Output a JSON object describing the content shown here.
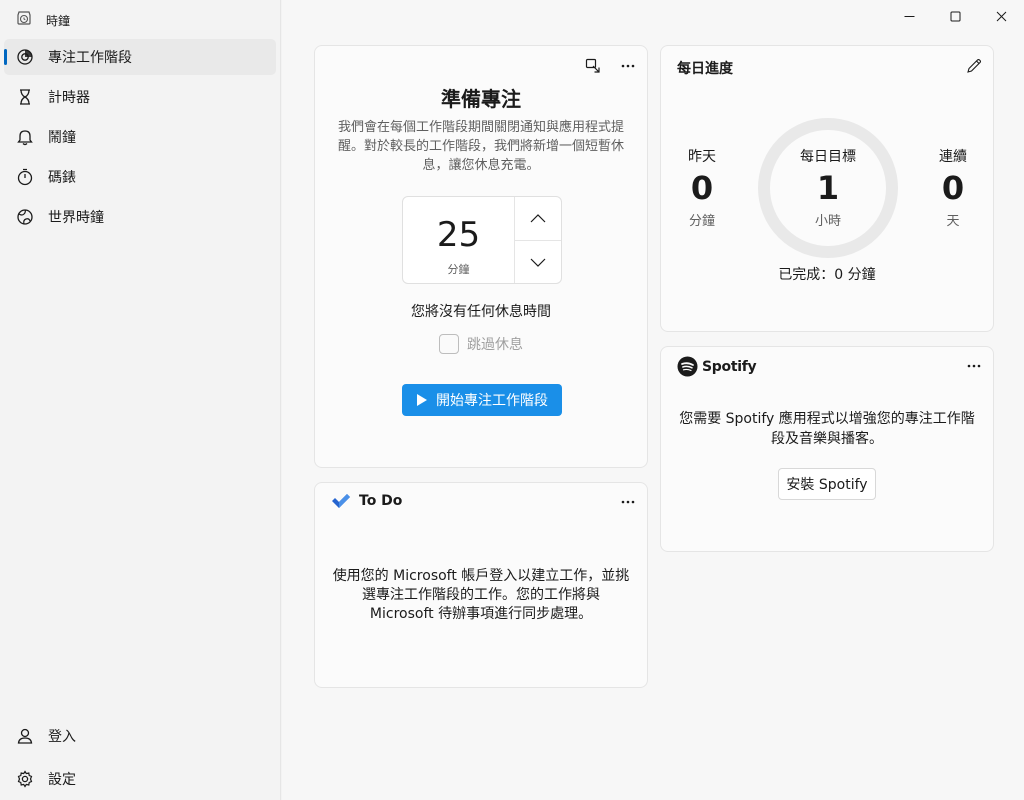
{
  "app": {
    "title": "時鐘"
  },
  "sidebar": {
    "items": [
      {
        "label": "專注工作階段",
        "icon": "focus-icon",
        "active": true
      },
      {
        "label": "計時器",
        "icon": "hourglass-icon"
      },
      {
        "label": "鬧鐘",
        "icon": "bell-icon"
      },
      {
        "label": "碼錶",
        "icon": "stopwatch-icon"
      },
      {
        "label": "世界時鐘",
        "icon": "globe-icon"
      }
    ],
    "footer": [
      {
        "label": "登入",
        "icon": "person-icon"
      },
      {
        "label": "設定",
        "icon": "gear-icon"
      }
    ]
  },
  "focus": {
    "title": "準備專注",
    "description": "我們會在每個工作階段期間關閉通知與應用程式提醒。對於較長的工作階段，我們將新增一個短暫休息，讓您休息充電。",
    "timer_value": "25",
    "timer_unit": "分鐘",
    "no_break_text": "您將沒有任何休息時間",
    "skip_break_label": "跳過休息",
    "start_button_label": "開始專注工作階段"
  },
  "daily_progress": {
    "title": "每日進度",
    "yesterday": {
      "label": "昨天",
      "value": "0",
      "unit": "分鐘"
    },
    "goal": {
      "label": "每日目標",
      "value": "1",
      "unit": "小時"
    },
    "streak": {
      "label": "連續",
      "value": "0",
      "unit": "天"
    },
    "completed_text": "已完成：0 分鐘"
  },
  "spotify": {
    "brand": "Spotify",
    "description": "您需要 Spotify 應用程式以增強您的專注工作階段及音樂與播客。",
    "install_label": "安裝 Spotify"
  },
  "todo": {
    "title": "To Do",
    "description": "使用您的 Microsoft 帳戶登入以建立工作，並挑選專注工作階段的工作。您的工作將與 Microsoft 待辦事項進行同步處理。"
  },
  "colors": {
    "accent": "#0067c0",
    "primary_button": "#1a8fe8",
    "spotify_logo": "#1b1b1b",
    "todo_logo": "#2564cf"
  }
}
